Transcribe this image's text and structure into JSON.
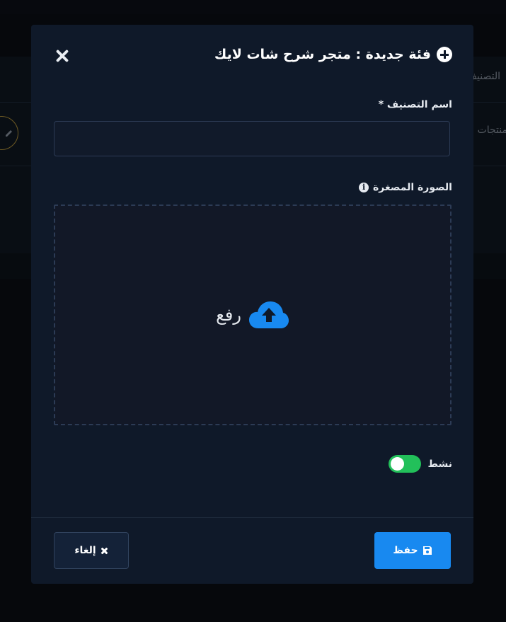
{
  "background": {
    "table_header_partial": "التصنيف",
    "table_row_partial": "منتجات"
  },
  "modal": {
    "title": "فئة جديدة : متجر شرح شات لايك",
    "title_icon": "plus-circle-icon",
    "close_icon": "close-icon",
    "fields": {
      "name_label": "اسم التصنيف *",
      "name_value": "",
      "thumbnail_label": "الصورة المصغرة",
      "thumbnail_info_icon": "info-icon",
      "upload_label": "رفع",
      "upload_icon": "cloud-upload-icon"
    },
    "active_toggle": {
      "label": "نشط",
      "on": true,
      "color": "#22c05a"
    },
    "footer": {
      "save_label": "حفظ",
      "save_icon": "save-icon",
      "cancel_label": "إلغاء",
      "cancel_icon": "x-icon"
    }
  },
  "colors": {
    "accent": "#1889f0",
    "modal_bg": "#0f1929",
    "page_bg": "#0b0f16"
  }
}
